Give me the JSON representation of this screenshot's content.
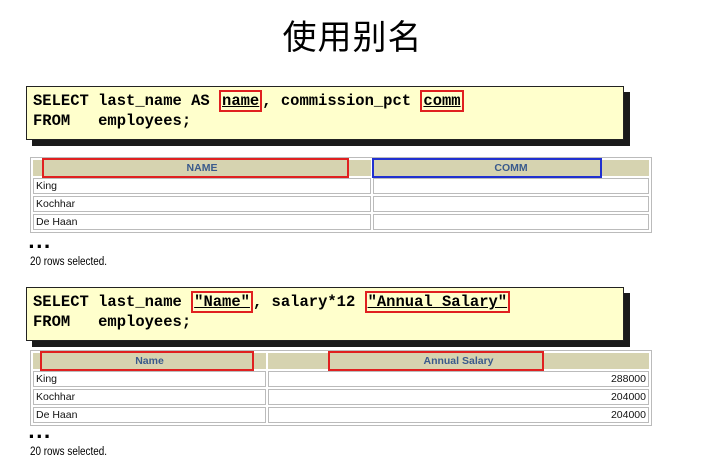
{
  "title": "使用别名",
  "example1": {
    "sql_line1_before": "SELECT last_name AS ",
    "alias1": "name",
    "sql_line1_mid": ", commission_pct ",
    "alias2": "comm",
    "sql_line2": "FROM   employees;",
    "columns": [
      "NAME",
      "COMM"
    ],
    "rows": [
      [
        "King",
        ""
      ],
      [
        "Kochhar",
        ""
      ],
      [
        "De Haan",
        ""
      ]
    ],
    "ellipsis": "...",
    "rows_selected": "20 rows selected."
  },
  "example2": {
    "sql_line1_before": "SELECT last_name ",
    "alias1": "\"Name\"",
    "sql_line1_mid": ", salary*12 ",
    "alias2": "\"Annual Salary\"",
    "sql_line2": "FROM   employees;",
    "columns": [
      "Name",
      "Annual Salary"
    ],
    "rows": [
      [
        "King",
        "288000"
      ],
      [
        "Kochhar",
        "204000"
      ],
      [
        "De Haan",
        "204000"
      ]
    ],
    "ellipsis": "...",
    "rows_selected": "20 rows selected."
  },
  "colors": {
    "highlight_red": "#e02020",
    "highlight_blue": "#2030d0",
    "sql_background": "#ffffcc",
    "header_background": "#d6d3b0",
    "header_text": "#3a5a8c"
  }
}
